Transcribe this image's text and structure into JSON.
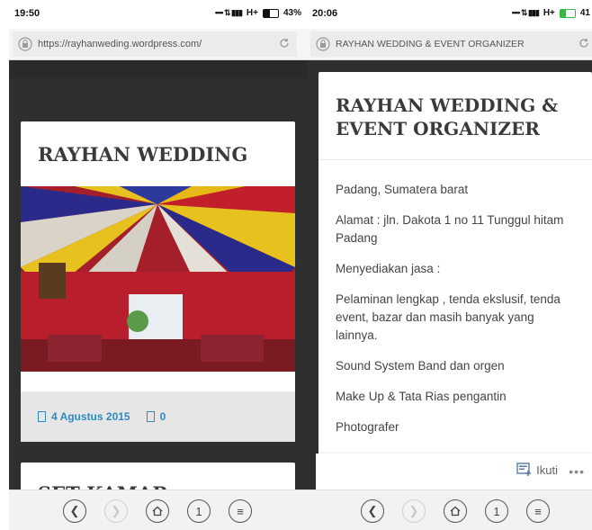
{
  "left": {
    "status": {
      "time": "19:50",
      "network": "H+",
      "battery_pct": "43%",
      "battery_level": 0.43
    },
    "url": "https://rayhanweding.wordpress.com/",
    "post": {
      "title": "RAYHAN WEDDING",
      "date": "4 Agustus 2015",
      "comments": "0"
    },
    "next_post_title": "SET KAMAR"
  },
  "right": {
    "status": {
      "time": "20:06",
      "network": "H+",
      "battery_pct": "41",
      "battery_level": 0.41
    },
    "url": "RAYHAN WEDDING & EVENT ORGANIZER",
    "title_line1": "RAYHAN WEDDING &",
    "title_line2": "EVENT ORGANIZER",
    "paragraphs": [
      "Padang, Sumatera barat",
      "Alamat : jln. Dakota 1 no 11 Tunggul hitam Padang",
      "Menyediakan jasa :",
      "Pelaminan lengkap , tenda ekslusif, tenda event, bazar dan masih banyak yang lainnya.",
      "Sound System Band dan orgen",
      "Make Up & Tata Rias pengantin",
      "Photografer"
    ],
    "follow_label": "Ikuti"
  },
  "nav": {
    "tab_count": "1"
  },
  "colors": {
    "link": "#2e8bc0",
    "battery_green": "#39b54a"
  },
  "icons": [
    "lock-icon",
    "reload-icon",
    "back-icon",
    "forward-icon",
    "home-icon",
    "tabs-icon",
    "menu-icon",
    "follow-icon",
    "more-icon",
    "calendar-icon",
    "comment-icon"
  ]
}
